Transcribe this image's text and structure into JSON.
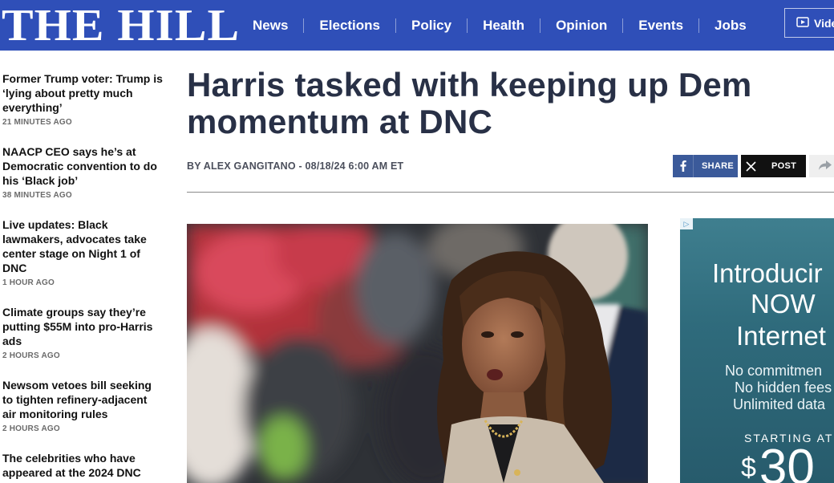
{
  "header": {
    "logo": "THE HILL",
    "nav": [
      "News",
      "Elections",
      "Policy",
      "Health",
      "Opinion",
      "Events",
      "Jobs"
    ],
    "video_label": "Vide"
  },
  "sidebar": {
    "stories": [
      {
        "title": "Former Trump voter: Trump is ‘lying about pretty much everything’",
        "time": "21 MINUTES AGO"
      },
      {
        "title": "NAACP CEO says he’s at Democratic convention to do his ‘Black job’",
        "time": "38 MINUTES AGO"
      },
      {
        "title": "Live updates: Black lawmakers, advocates take center stage on Night 1 of DNC",
        "time": "1 HOUR AGO"
      },
      {
        "title": "Climate groups say they’re putting $55M into pro-Harris ads",
        "time": "2 HOURS AGO"
      },
      {
        "title": "Newsom vetoes bill seeking to tighten refinery-adjacent air monitoring rules",
        "time": "2 HOURS AGO"
      },
      {
        "title": "The celebrities who have appeared at the 2024 DNC",
        "time": ""
      }
    ]
  },
  "article": {
    "headline": "Harris tasked with keeping up Dem momentum at DNC",
    "byline": "BY ALEX GANGITANO - 08/18/24 6:00 AM ET",
    "share": {
      "facebook_label": "SHARE",
      "x_label": "POST"
    }
  },
  "ad": {
    "badge": "▷",
    "line1": "Introducir",
    "line2": "NOW",
    "line3": "Internet",
    "small1": "No commitmen",
    "small2": "No hidden fees",
    "small3": "Unlimited data",
    "starting": "STARTING AT",
    "currency": "$",
    "price": "30"
  },
  "colors": {
    "header_bg": "#2f4fb8",
    "facebook": "#3b5a9a",
    "x": "#111111"
  },
  "icons": {
    "video": "play-icon",
    "facebook": "facebook-icon",
    "x": "x-logo-icon",
    "more_share": "share-arrow-icon"
  }
}
